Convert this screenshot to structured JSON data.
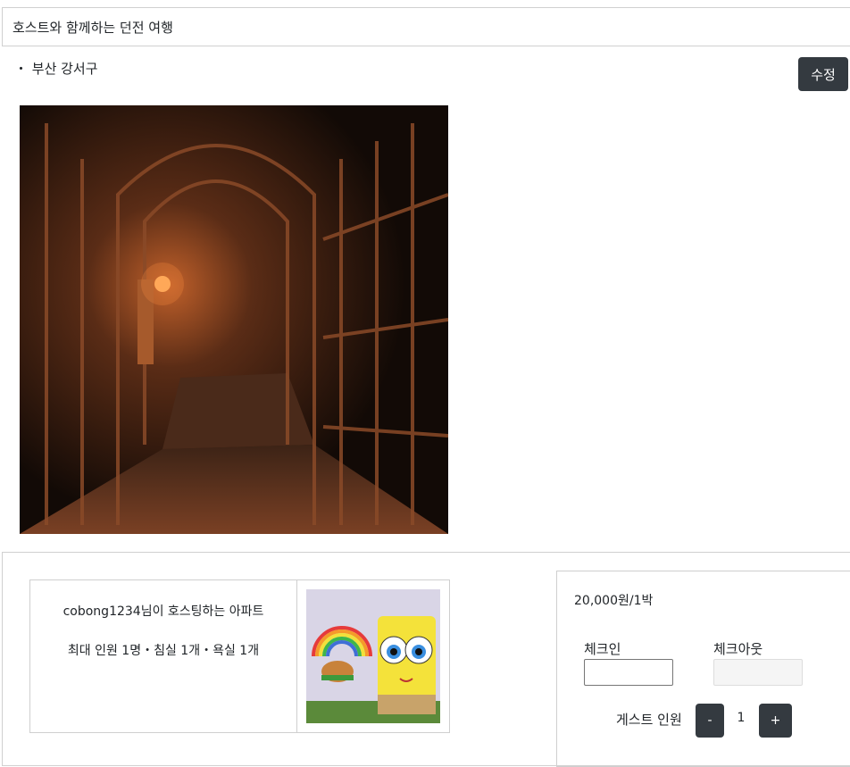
{
  "listing": {
    "title": "호스트와 함께하는 던전 여행",
    "location": "・ 부산 강서구",
    "edit_label": "수정"
  },
  "host_info": {
    "hosting_line": "cobong1234님이 호스팅하는 아파트",
    "capacity_line": "최대 인원 1명・침실 1개・욕실 1개"
  },
  "booking": {
    "price": "20,000원/1박",
    "checkin_label": "체크인",
    "checkout_label": "체크아웃",
    "guest_label": "게스트 인원",
    "minus_label": "-",
    "guest_count": "1",
    "plus_label": "+"
  },
  "colors": {
    "button_dark": "#343a40",
    "border": "#d0d0d0"
  }
}
